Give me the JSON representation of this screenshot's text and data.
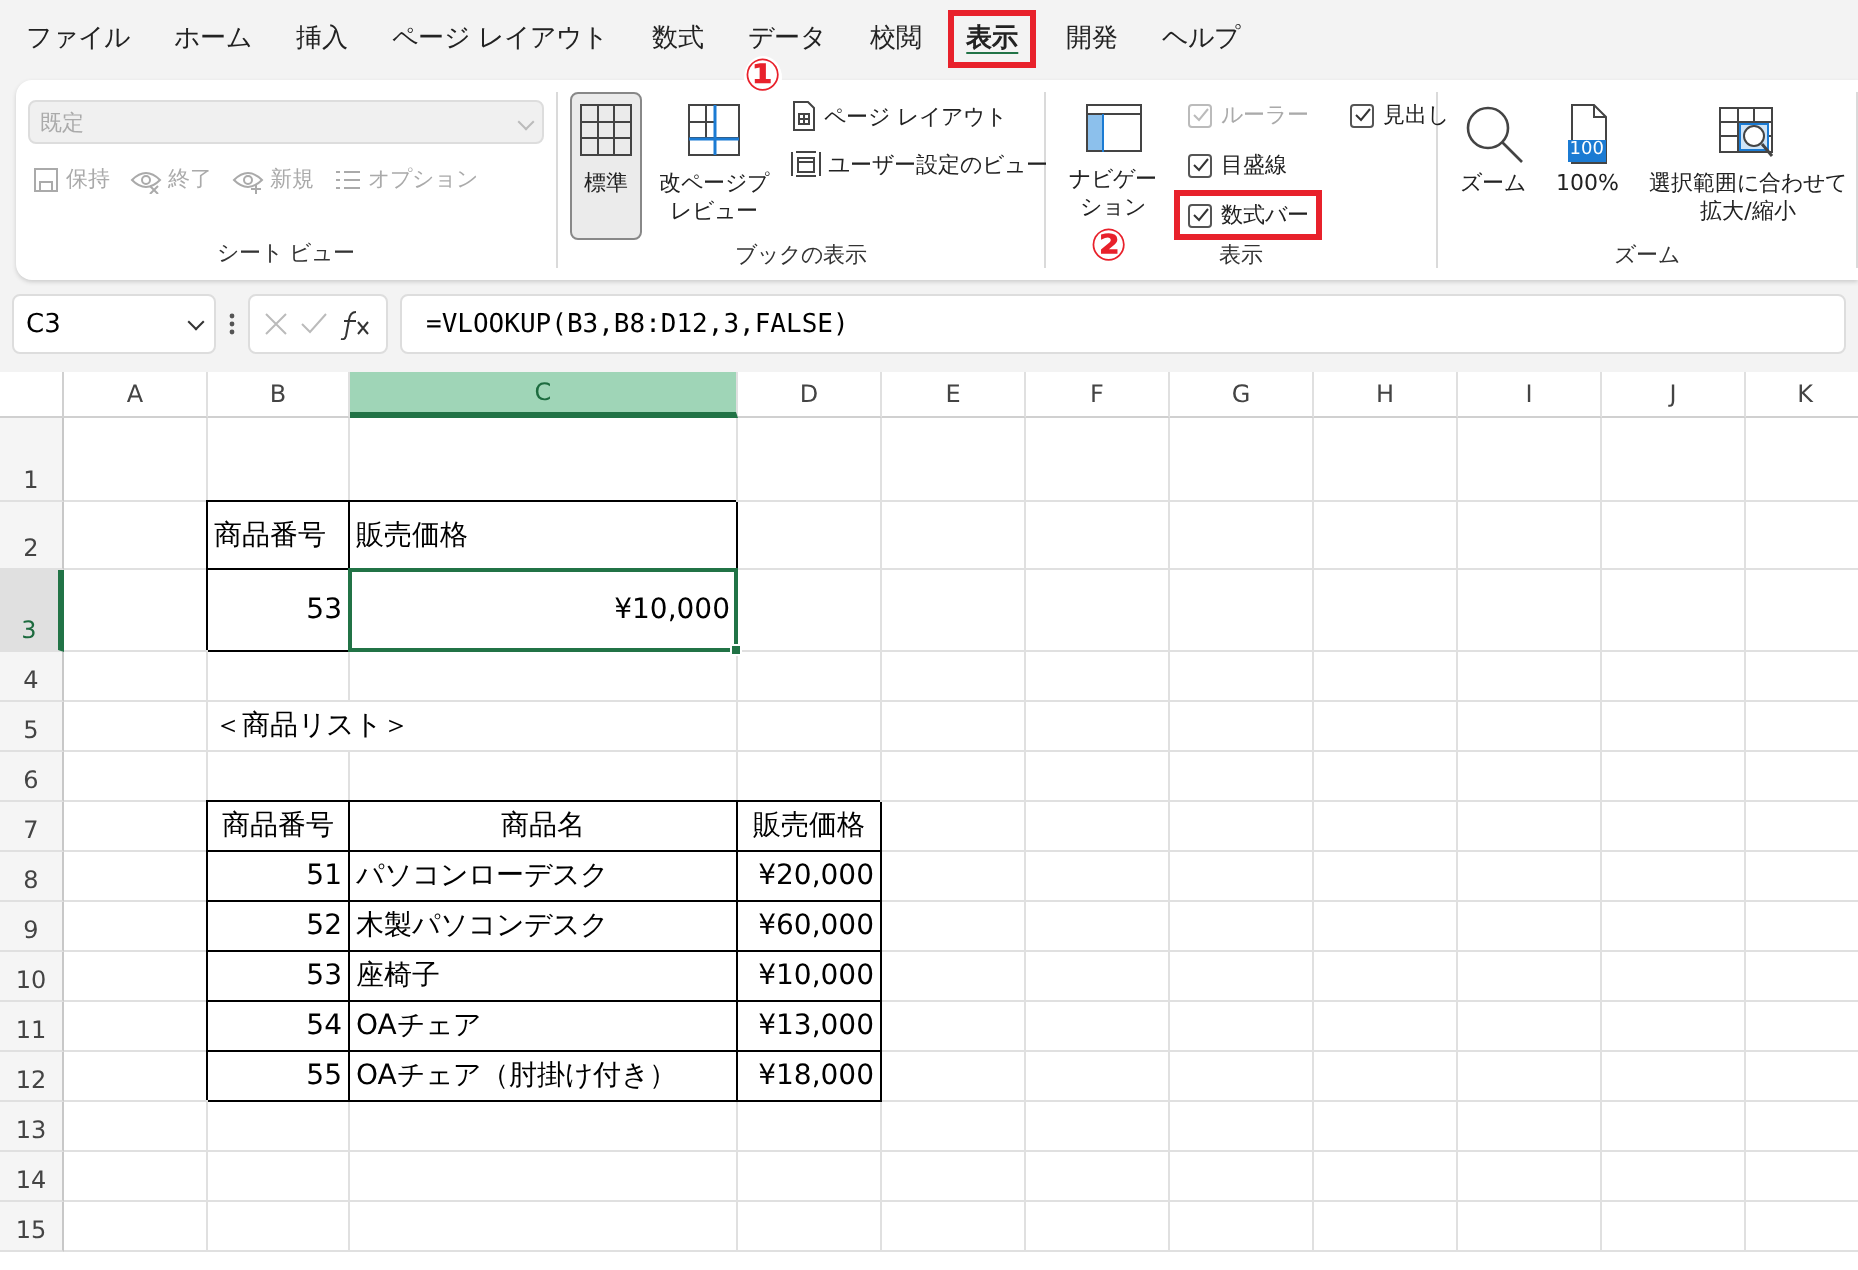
{
  "menu_tabs": [
    {
      "label": "ファイル",
      "selected": false,
      "highlighted": false
    },
    {
      "label": "ホーム",
      "selected": false,
      "highlighted": false
    },
    {
      "label": "挿入",
      "selected": false,
      "highlighted": false
    },
    {
      "label": "ページ レイアウト",
      "selected": false,
      "highlighted": false
    },
    {
      "label": "数式",
      "selected": false,
      "highlighted": false
    },
    {
      "label": "データ",
      "selected": false,
      "highlighted": false
    },
    {
      "label": "校閲",
      "selected": false,
      "highlighted": false
    },
    {
      "label": "表示",
      "selected": true,
      "highlighted": true
    },
    {
      "label": "開発",
      "selected": false,
      "highlighted": false
    },
    {
      "label": "ヘルプ",
      "selected": false,
      "highlighted": false
    }
  ],
  "annotations": [
    {
      "text": "①"
    },
    {
      "text": "②"
    }
  ],
  "ribbon": {
    "sheet_view": {
      "label": "シート ビュー",
      "dropdown": "既定",
      "buttons": [
        {
          "kind": "save",
          "label": "保持",
          "disabled": true
        },
        {
          "kind": "exit",
          "label": "終了",
          "disabled": true
        },
        {
          "kind": "new",
          "label": "新規",
          "disabled": true
        },
        {
          "kind": "options",
          "label": "オプション",
          "disabled": true
        }
      ]
    },
    "workbook_views": {
      "label": "ブックの表示",
      "large": [
        {
          "kind": "normal",
          "label": "標準",
          "selected": true
        },
        {
          "kind": "pagebreak",
          "label": "改ページプレビュー",
          "selected": false
        }
      ],
      "small": [
        {
          "kind": "pagelayout",
          "label": "ページ レイアウト"
        },
        {
          "kind": "customview",
          "label": "ユーザー設定のビュー"
        }
      ]
    },
    "show": {
      "label": "表示",
      "navigation": "ナビゲーション",
      "checkboxes": [
        {
          "label": "ルーラー",
          "checked": true,
          "disabled": true,
          "highlighted": false
        },
        {
          "label": "目盛線",
          "checked": true,
          "disabled": false,
          "highlighted": false
        },
        {
          "label": "数式バー",
          "checked": true,
          "disabled": false,
          "highlighted": true
        },
        {
          "label": "見出し",
          "checked": true,
          "disabled": false,
          "highlighted": false
        }
      ]
    },
    "zoom": {
      "label": "ズーム",
      "buttons": [
        {
          "kind": "zoom",
          "label": "ズーム"
        },
        {
          "kind": "hundred",
          "label": "100%",
          "badge": "100"
        },
        {
          "kind": "selection",
          "label": "選択範囲に合わせて拡大/縮小"
        }
      ]
    }
  },
  "formula_bar": {
    "name_box": "C3",
    "formula": "=VLOOKUP(B3,B8:D12,3,FALSE)"
  },
  "columns": [
    {
      "label": "A",
      "selected": false
    },
    {
      "label": "B",
      "selected": false
    },
    {
      "label": "C",
      "selected": true
    },
    {
      "label": "D",
      "selected": false
    },
    {
      "label": "E",
      "selected": false
    },
    {
      "label": "F",
      "selected": false
    },
    {
      "label": "G",
      "selected": false
    },
    {
      "label": "H",
      "selected": false
    },
    {
      "label": "I",
      "selected": false
    },
    {
      "label": "J",
      "selected": false
    },
    {
      "label": "K",
      "selected": false
    }
  ],
  "rows": [
    {
      "label": "1",
      "selected": false
    },
    {
      "label": "2",
      "selected": false
    },
    {
      "label": "3",
      "selected": true
    },
    {
      "label": "4",
      "selected": false
    },
    {
      "label": "5",
      "selected": false
    },
    {
      "label": "6",
      "selected": false
    },
    {
      "label": "7",
      "selected": false
    },
    {
      "label": "8",
      "selected": false
    },
    {
      "label": "9",
      "selected": false
    },
    {
      "label": "10",
      "selected": false
    },
    {
      "label": "11",
      "selected": false
    },
    {
      "label": "12",
      "selected": false
    },
    {
      "label": "13",
      "selected": false
    },
    {
      "label": "14",
      "selected": false
    },
    {
      "label": "15",
      "selected": false
    }
  ],
  "lookup_table": {
    "headers": [
      "商品番号",
      "販売価格"
    ],
    "values": [
      {
        "text": "53",
        "active": false
      },
      {
        "text": "¥10,000",
        "active": true
      }
    ]
  },
  "list_title": "＜商品リスト＞",
  "product_table": {
    "headers": [
      "商品番号",
      "商品名",
      "販売価格"
    ],
    "rows": [
      [
        "51",
        "パソコンローデスク",
        "¥20,000"
      ],
      [
        "52",
        "木製パソコンデスク",
        "¥60,000"
      ],
      [
        "53",
        "座椅子",
        "¥10,000"
      ],
      [
        "54",
        "OAチェア",
        "¥13,000"
      ],
      [
        "55",
        "OAチェア（肘掛け付き）",
        "¥18,000"
      ]
    ]
  }
}
